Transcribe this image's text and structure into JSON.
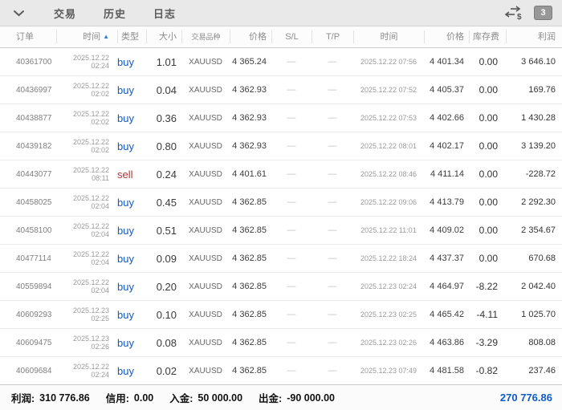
{
  "topbar": {
    "tabs": [
      {
        "label": "交易"
      },
      {
        "label": "历史"
      },
      {
        "label": "日志"
      }
    ],
    "badge": "3"
  },
  "table": {
    "headers": [
      "订单",
      "时间",
      "类型",
      "大小",
      "交易品种",
      "价格",
      "S/L",
      "T/P",
      "时间",
      "价格",
      "库存费",
      "利润"
    ],
    "sort_indicator": "▲",
    "rows": [
      {
        "order": "40361700",
        "open_time": "2025.12.22 02:24",
        "type": "buy",
        "size": "1.01",
        "symbol": "XAUUSD",
        "open_price": "4 365.24",
        "sl": "—",
        "tp": "—",
        "close_time": "2025.12.22 07:56",
        "close_price": "4 401.34",
        "swap": "0.00",
        "profit": "3 646.10"
      },
      {
        "order": "40436997",
        "open_time": "2025.12.22 02:02",
        "type": "buy",
        "size": "0.04",
        "symbol": "XAUUSD",
        "open_price": "4 362.93",
        "sl": "—",
        "tp": "—",
        "close_time": "2025.12.22 07:52",
        "close_price": "4 405.37",
        "swap": "0.00",
        "profit": "169.76"
      },
      {
        "order": "40438877",
        "open_time": "2025.12.22 02:02",
        "type": "buy",
        "size": "0.36",
        "symbol": "XAUUSD",
        "open_price": "4 362.93",
        "sl": "—",
        "tp": "—",
        "close_time": "2025.12.22 07:53",
        "close_price": "4 402.66",
        "swap": "0.00",
        "profit": "1 430.28"
      },
      {
        "order": "40439182",
        "open_time": "2025.12.22 02:02",
        "type": "buy",
        "size": "0.80",
        "symbol": "XAUUSD",
        "open_price": "4 362.93",
        "sl": "—",
        "tp": "—",
        "close_time": "2025.12.22 08:01",
        "close_price": "4 402.17",
        "swap": "0.00",
        "profit": "3 139.20"
      },
      {
        "order": "40443077",
        "open_time": "2025.12.22 08:11",
        "type": "sell",
        "size": "0.24",
        "symbol": "XAUUSD",
        "open_price": "4 401.61",
        "sl": "—",
        "tp": "—",
        "close_time": "2025.12.22 08:46",
        "close_price": "4 411.14",
        "swap": "0.00",
        "profit": "-228.72"
      },
      {
        "order": "40458025",
        "open_time": "2025.12.22 02:04",
        "type": "buy",
        "size": "0.45",
        "symbol": "XAUUSD",
        "open_price": "4 362.85",
        "sl": "—",
        "tp": "—",
        "close_time": "2025.12.22 09:06",
        "close_price": "4 413.79",
        "swap": "0.00",
        "profit": "2 292.30"
      },
      {
        "order": "40458100",
        "open_time": "2025.12.22 02:04",
        "type": "buy",
        "size": "0.51",
        "symbol": "XAUUSD",
        "open_price": "4 362.85",
        "sl": "—",
        "tp": "—",
        "close_time": "2025.12.22 11:01",
        "close_price": "4 409.02",
        "swap": "0.00",
        "profit": "2 354.67"
      },
      {
        "order": "40477114",
        "open_time": "2025.12.22 02:04",
        "type": "buy",
        "size": "0.09",
        "symbol": "XAUUSD",
        "open_price": "4 362.85",
        "sl": "—",
        "tp": "—",
        "close_time": "2025.12.22 18:24",
        "close_price": "4 437.37",
        "swap": "0.00",
        "profit": "670.68"
      },
      {
        "order": "40559894",
        "open_time": "2025.12.22 02:04",
        "type": "buy",
        "size": "0.20",
        "symbol": "XAUUSD",
        "open_price": "4 362.85",
        "sl": "—",
        "tp": "—",
        "close_time": "2025.12.23 02:24",
        "close_price": "4 464.97",
        "swap": "-8.22",
        "profit": "2 042.40"
      },
      {
        "order": "40609293",
        "open_time": "2025.12.23 02:25",
        "type": "buy",
        "size": "0.10",
        "symbol": "XAUUSD",
        "open_price": "4 362.85",
        "sl": "—",
        "tp": "—",
        "close_time": "2025.12.23 02:25",
        "close_price": "4 465.42",
        "swap": "-4.11",
        "profit": "1 025.70"
      },
      {
        "order": "40609475",
        "open_time": "2025.12.23 02:26",
        "type": "buy",
        "size": "0.08",
        "symbol": "XAUUSD",
        "open_price": "4 362.85",
        "sl": "—",
        "tp": "—",
        "close_time": "2025.12.23 02:26",
        "close_price": "4 463.86",
        "swap": "-3.29",
        "profit": "808.08"
      },
      {
        "order": "40609684",
        "open_time": "2025.12.22 02:24",
        "type": "buy",
        "size": "0.02",
        "symbol": "XAUUSD",
        "open_price": "4 362.85",
        "sl": "—",
        "tp": "—",
        "close_time": "2025.12.23 07:49",
        "close_price": "4 481.58",
        "swap": "-0.82",
        "profit": "237.46"
      }
    ]
  },
  "summary": {
    "items": [
      {
        "label": "利润:",
        "value": "310 776.86"
      },
      {
        "label": "信用:",
        "value": "0.00"
      },
      {
        "label": "入金:",
        "value": "50 000.00"
      },
      {
        "label": "出金:",
        "value": "-90 000.00"
      }
    ],
    "balance": "270 776.86"
  },
  "colors": {
    "buy_blue": "#0f5bc5",
    "sell_red": "#b23434",
    "balance_blue": "#0f5bc5",
    "sort_arrow_blue": "#2f80d8"
  }
}
